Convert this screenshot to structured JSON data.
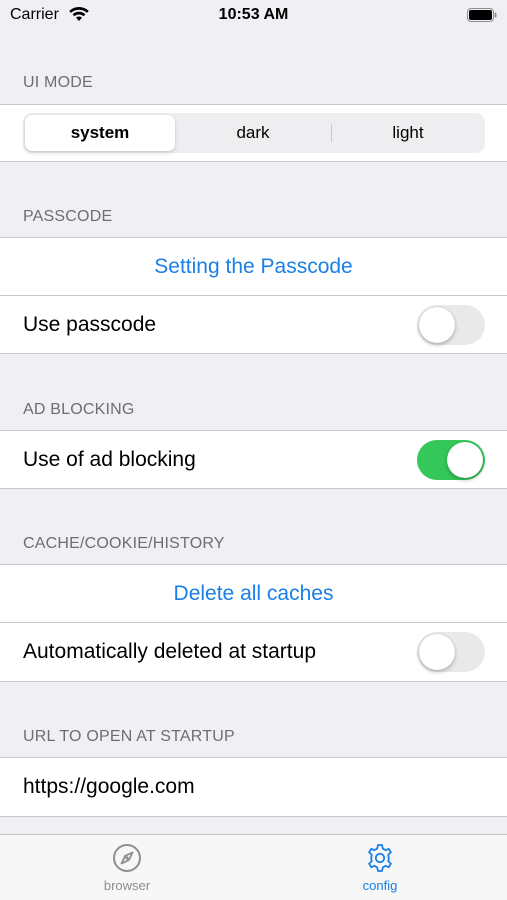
{
  "status_bar": {
    "carrier": "Carrier",
    "time": "10:53 AM"
  },
  "ui_mode": {
    "header": "UI MODE",
    "options": [
      "system",
      "dark",
      "light"
    ],
    "selected": "system"
  },
  "passcode": {
    "header": "PASSCODE",
    "action": "Setting the Passcode",
    "toggle_label": "Use passcode",
    "toggle_on": false
  },
  "ad_blocking": {
    "header": "AD BLOCKING",
    "toggle_label": "Use of ad blocking",
    "toggle_on": true
  },
  "cache": {
    "header": "CACHE/COOKIE/HISTORY",
    "action": "Delete all caches",
    "toggle_label": "Automatically deleted at startup",
    "toggle_on": false
  },
  "startup_url": {
    "header": "URL TO OPEN AT STARTUP",
    "value": "https://google.com"
  },
  "tab_bar": {
    "tabs": [
      {
        "label": "browser",
        "icon": "compass-icon",
        "active": false
      },
      {
        "label": "config",
        "icon": "gear-icon",
        "active": true
      }
    ]
  },
  "colors": {
    "accent": "#1a7fe6",
    "toggle_on": "#34c759",
    "toggle_off": "#e9e9ea",
    "background": "#efeff4",
    "section_header": "#6d6d72"
  }
}
